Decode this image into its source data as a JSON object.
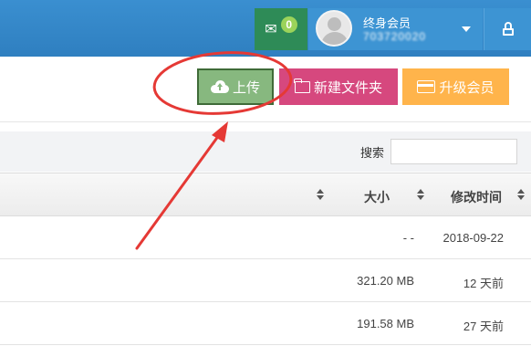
{
  "header": {
    "messages": {
      "icon": "envelope-icon",
      "count": "0"
    },
    "user": {
      "avatar_icon": "user-avatar-icon",
      "name": "终身会员",
      "id_blurred": "703720020"
    },
    "dropdown_icon": "chevron-down-icon",
    "lock_icon": "lock-icon"
  },
  "toolbar": {
    "upload": {
      "icon": "cloud-upload-icon",
      "label": "上传"
    },
    "new_folder": {
      "icon": "folder-icon",
      "label": "新建文件夹"
    },
    "upgrade": {
      "icon": "credit-card-icon",
      "label": "升级会员"
    }
  },
  "search": {
    "label": "搜索",
    "value": ""
  },
  "table": {
    "columns": [
      {
        "label": "",
        "sort_icon": "sort-icon"
      },
      {
        "label": "大小",
        "sort_icon": "sort-icon"
      },
      {
        "label": "修改时间",
        "sort_icon": "sort-icon"
      }
    ],
    "rows": [
      {
        "size": "- -",
        "modified": "2018-09-22"
      },
      {
        "size": "321.20 MB",
        "modified": "12 天前"
      },
      {
        "size": "191.58 MB",
        "modified": "27 天前"
      }
    ]
  },
  "colors": {
    "header_blue": "#2f7fc0",
    "messages_green": "#2e8b57",
    "upload_green": "#87b87f",
    "new_folder_pink": "#d6487e",
    "upgrade_orange": "#ffb44b",
    "annotation_red": "#e53935"
  }
}
